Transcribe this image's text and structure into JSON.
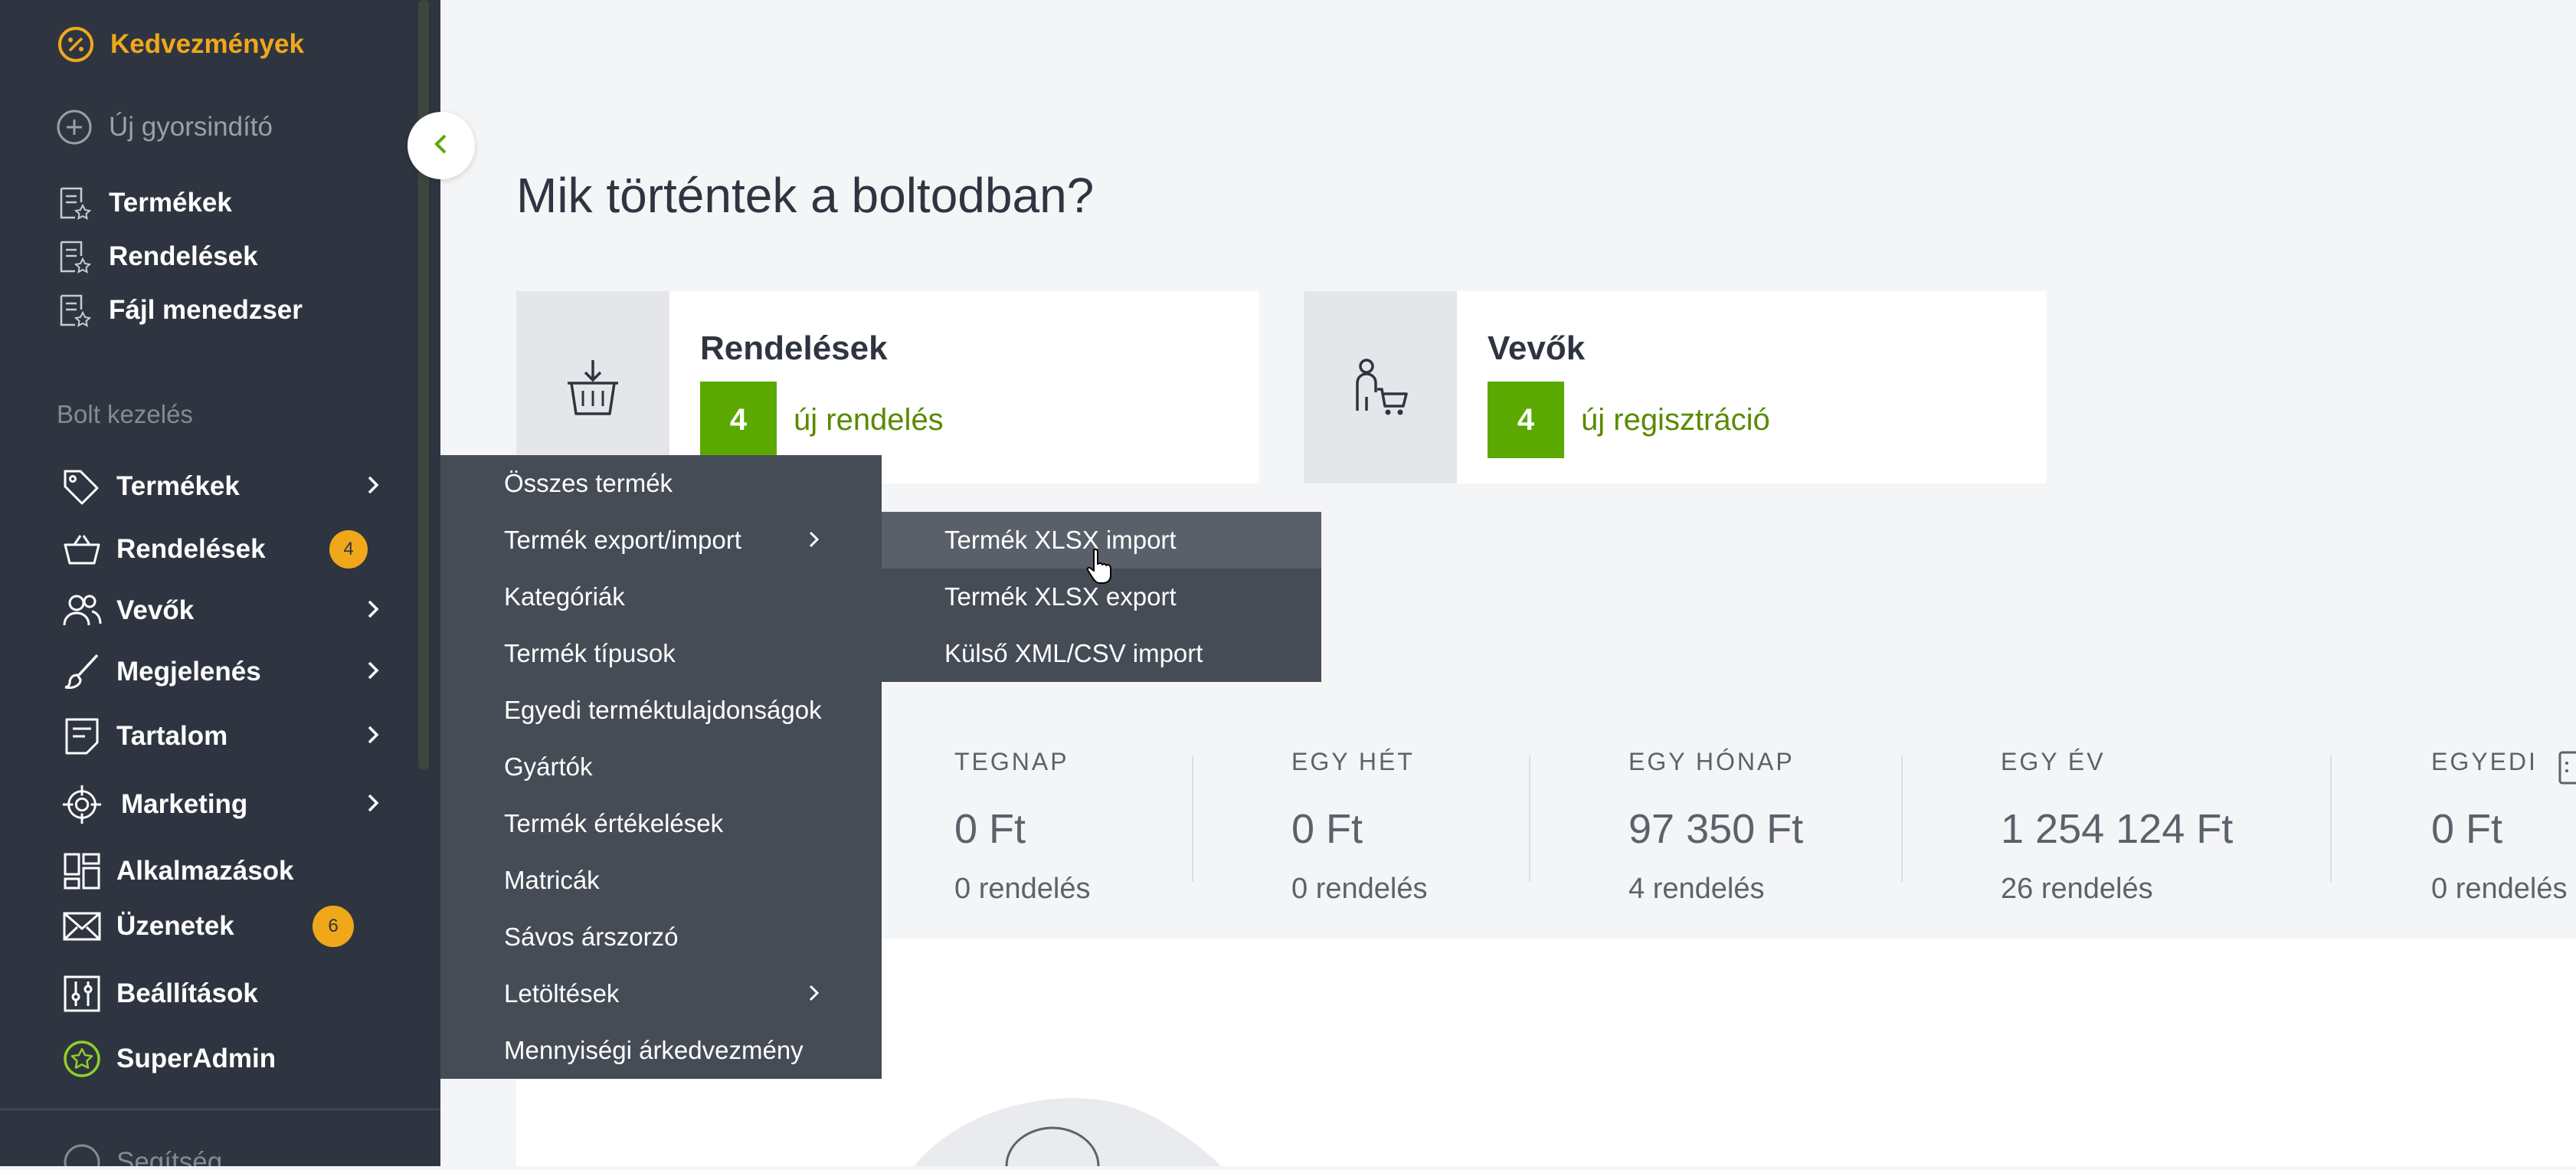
{
  "sidebar": {
    "quick": [
      {
        "label": "Kedvezmények",
        "icon": "percent-circle-icon"
      },
      {
        "label": "Új gyorsindító",
        "icon": "plus-circle-icon"
      },
      {
        "label": "Termékek",
        "icon": "list-star-icon"
      },
      {
        "label": "Rendelések",
        "icon": "list-star-icon"
      },
      {
        "label": "Fájl menedzser",
        "icon": "list-star-icon"
      }
    ],
    "section_label": "Bolt kezelés",
    "items": [
      {
        "label": "Termékek",
        "icon": "tag-icon"
      },
      {
        "label": "Rendelések",
        "icon": "basket-icon",
        "badge": "4"
      },
      {
        "label": "Vevők",
        "icon": "users-icon"
      },
      {
        "label": "Megjelenés",
        "icon": "brush-icon"
      },
      {
        "label": "Tartalom",
        "icon": "document-icon"
      },
      {
        "label": "Marketing",
        "icon": "target-icon"
      },
      {
        "label": "Alkalmazások",
        "icon": "apps-grid-icon"
      },
      {
        "label": "Üzenetek",
        "icon": "envelope-icon",
        "badge": "6"
      },
      {
        "label": "Beállítások",
        "icon": "sliders-icon"
      },
      {
        "label": "SuperAdmin",
        "icon": "star-circle-icon"
      }
    ],
    "help_label": "Segítség"
  },
  "main": {
    "title": "Mik történtek a boltodban?",
    "cards": [
      {
        "title": "Rendelések",
        "count": "4",
        "link": "új rendelés",
        "icon": "basket-download-icon"
      },
      {
        "title": "Vevők",
        "count": "4",
        "link": "új regisztráció",
        "icon": "person-cart-icon"
      }
    ],
    "stats": [
      {
        "label": "TEGNAP",
        "value": "0 Ft",
        "sub": "0 rendelés"
      },
      {
        "label": "EGY HÉT",
        "value": "0 Ft",
        "sub": "0 rendelés"
      },
      {
        "label": "EGY HÓNAP",
        "value": "97 350 Ft",
        "sub": "4 rendelés"
      },
      {
        "label": "EGY ÉV",
        "value": "1 254 124 Ft",
        "sub": "26 rendelés"
      },
      {
        "label": "EGYEDI",
        "value": "0 Ft",
        "sub": "0 rendelés"
      }
    ]
  },
  "products_menu": {
    "items": [
      {
        "label": "Összes termék"
      },
      {
        "label": "Termék export/import",
        "submenu": true
      },
      {
        "label": "Kategóriák"
      },
      {
        "label": "Termék típusok"
      },
      {
        "label": "Egyedi terméktulajdonságok"
      },
      {
        "label": "Gyártók"
      },
      {
        "label": "Termék értékelések"
      },
      {
        "label": "Matricák"
      },
      {
        "label": "Sávos árszorzó"
      },
      {
        "label": "Letöltések",
        "submenu": true
      },
      {
        "label": "Mennyiségi árkedvezmény"
      }
    ]
  },
  "export_import_menu": {
    "items": [
      {
        "label": "Termék XLSX import",
        "hovered": true
      },
      {
        "label": "Termék XLSX export"
      },
      {
        "label": "Külső XML/CSV import"
      }
    ]
  },
  "colors": {
    "sidebar_bg": "#2f3540",
    "accent": "#5aa800",
    "badge": "#f0a81a",
    "highlight": "#f0a81a"
  }
}
